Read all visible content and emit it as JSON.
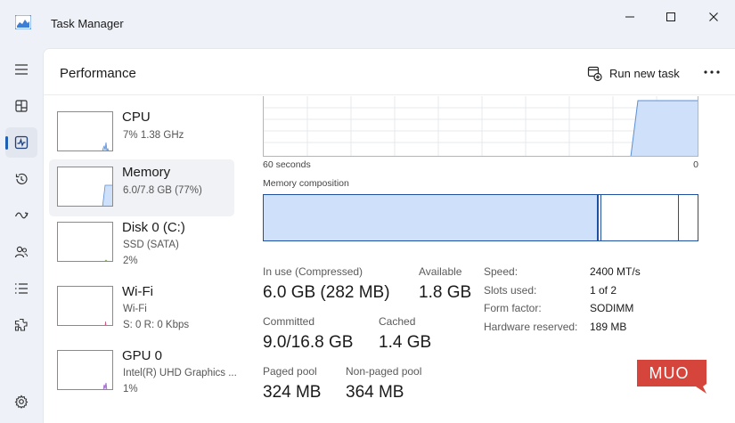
{
  "window": {
    "title": "Task Manager"
  },
  "header": {
    "title": "Performance",
    "run_new_task_label": "Run new task"
  },
  "nav": {
    "items": [
      {
        "name": "hamburger-icon"
      },
      {
        "name": "processes-icon"
      },
      {
        "name": "performance-icon",
        "active": true
      },
      {
        "name": "app-history-icon"
      },
      {
        "name": "startup-apps-icon"
      },
      {
        "name": "users-icon"
      },
      {
        "name": "details-icon"
      },
      {
        "name": "services-icon"
      },
      {
        "name": "settings-icon"
      }
    ]
  },
  "resources": [
    {
      "name": "CPU",
      "line1": "7%  1.38 GHz"
    },
    {
      "name": "Memory",
      "line1": "6.0/7.8 GB (77%)",
      "selected": true
    },
    {
      "name": "Disk 0 (C:)",
      "line1": "SSD (SATA)",
      "line2": "2%"
    },
    {
      "name": "Wi-Fi",
      "line1": "Wi-Fi",
      "line2": "S: 0  R: 0 Kbps"
    },
    {
      "name": "GPU 0",
      "line1": "Intel(R) UHD Graphics ...",
      "line2": "1%"
    }
  ],
  "graph": {
    "time_label": "60 seconds",
    "end_label": "0",
    "composition_label": "Memory composition"
  },
  "stats": {
    "in_use_label": "In use (Compressed)",
    "in_use_value": "6.0 GB (282 MB)",
    "available_label": "Available",
    "available_value": "1.8 GB",
    "committed_label": "Committed",
    "committed_value": "9.0/16.8 GB",
    "cached_label": "Cached",
    "cached_value": "1.4 GB",
    "paged_pool_label": "Paged pool",
    "paged_pool_value": "324 MB",
    "non_paged_pool_label": "Non-paged pool",
    "non_paged_pool_value": "364 MB"
  },
  "specs": {
    "speed_label": "Speed:",
    "speed_value": "2400 MT/s",
    "slots_label": "Slots used:",
    "slots_value": "1 of 2",
    "form_factor_label": "Form factor:",
    "form_factor_value": "SODIMM",
    "hw_reserved_label": "Hardware reserved:",
    "hw_reserved_value": "189 MB"
  },
  "watermark": {
    "text": "MUO"
  },
  "colors": {
    "accent": "#1f4fa0",
    "memory_fill": "#cfe0fb",
    "watermark_bg": "#d6453b"
  }
}
